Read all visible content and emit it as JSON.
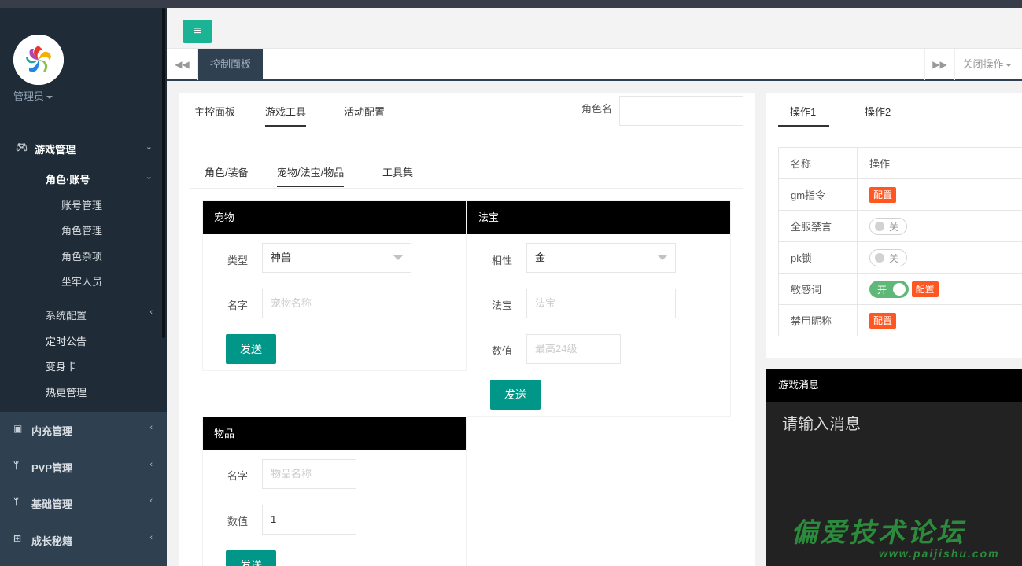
{
  "sidebar": {
    "admin_label": "管理员",
    "menu": [
      {
        "label": "游戏管理",
        "icon": "gamepad-icon"
      },
      {
        "label": "角色·账号"
      },
      {
        "label": "账号管理"
      },
      {
        "label": "角色管理"
      },
      {
        "label": "角色杂项"
      },
      {
        "label": "坐牢人员"
      },
      {
        "label": "系统配置"
      },
      {
        "label": "定时公告"
      },
      {
        "label": "变身卡"
      },
      {
        "label": "热更管理"
      },
      {
        "label": "内充管理",
        "icon": "money-icon"
      },
      {
        "label": "PVP管理",
        "icon": "cutlery-icon"
      },
      {
        "label": "基础管理",
        "icon": "cutlery-icon"
      },
      {
        "label": "成长秘籍",
        "icon": "table-icon"
      }
    ]
  },
  "header": {
    "menu_icon": "≡"
  },
  "tabbar": {
    "active_tab": "控制面板",
    "close_ops": "关闭操作"
  },
  "main": {
    "tabs": [
      "主控面板",
      "游戏工具",
      "活动配置"
    ],
    "role_label": "角色名",
    "subtabs": [
      "角色/装备",
      "宠物/法宝/物品",
      "工具集"
    ],
    "pet": {
      "title": "宠物",
      "type_label": "类型",
      "type_value": "神兽",
      "name_label": "名字",
      "name_placeholder": "宠物名称",
      "send": "发送"
    },
    "treasure": {
      "title": "法宝",
      "attr_label": "相性",
      "attr_value": "金",
      "name_label": "法宝",
      "name_placeholder": "法宝",
      "value_label": "数值",
      "value_placeholder": "最高24级",
      "send": "发送"
    },
    "item": {
      "title": "物品",
      "name_label": "名字",
      "name_placeholder": "物品名称",
      "value_label": "数值",
      "value_value": "1",
      "send": "发送"
    }
  },
  "right": {
    "tabs": [
      "操作1",
      "操作2"
    ],
    "table_headers": [
      "名称",
      "操作"
    ],
    "rows": [
      {
        "name": "gm指令",
        "badge": "配置"
      },
      {
        "name": "全服禁言",
        "switch": "关"
      },
      {
        "name": "pk锁",
        "switch": "关"
      },
      {
        "name": "敏感词",
        "switch": "开",
        "badge": "配置"
      },
      {
        "name": "禁用昵称",
        "badge": "配置"
      }
    ],
    "message_title": "游戏消息",
    "message_placeholder": "请输入消息"
  },
  "watermark": {
    "line1": "偏爱技术论坛",
    "line2": "www.paijishu.com"
  },
  "colors": {
    "sidebar": "#1f2b36",
    "accent": "#1ab394",
    "send_button": "#009688",
    "badge": "#ff5722",
    "switch_on": "#5fb878"
  }
}
